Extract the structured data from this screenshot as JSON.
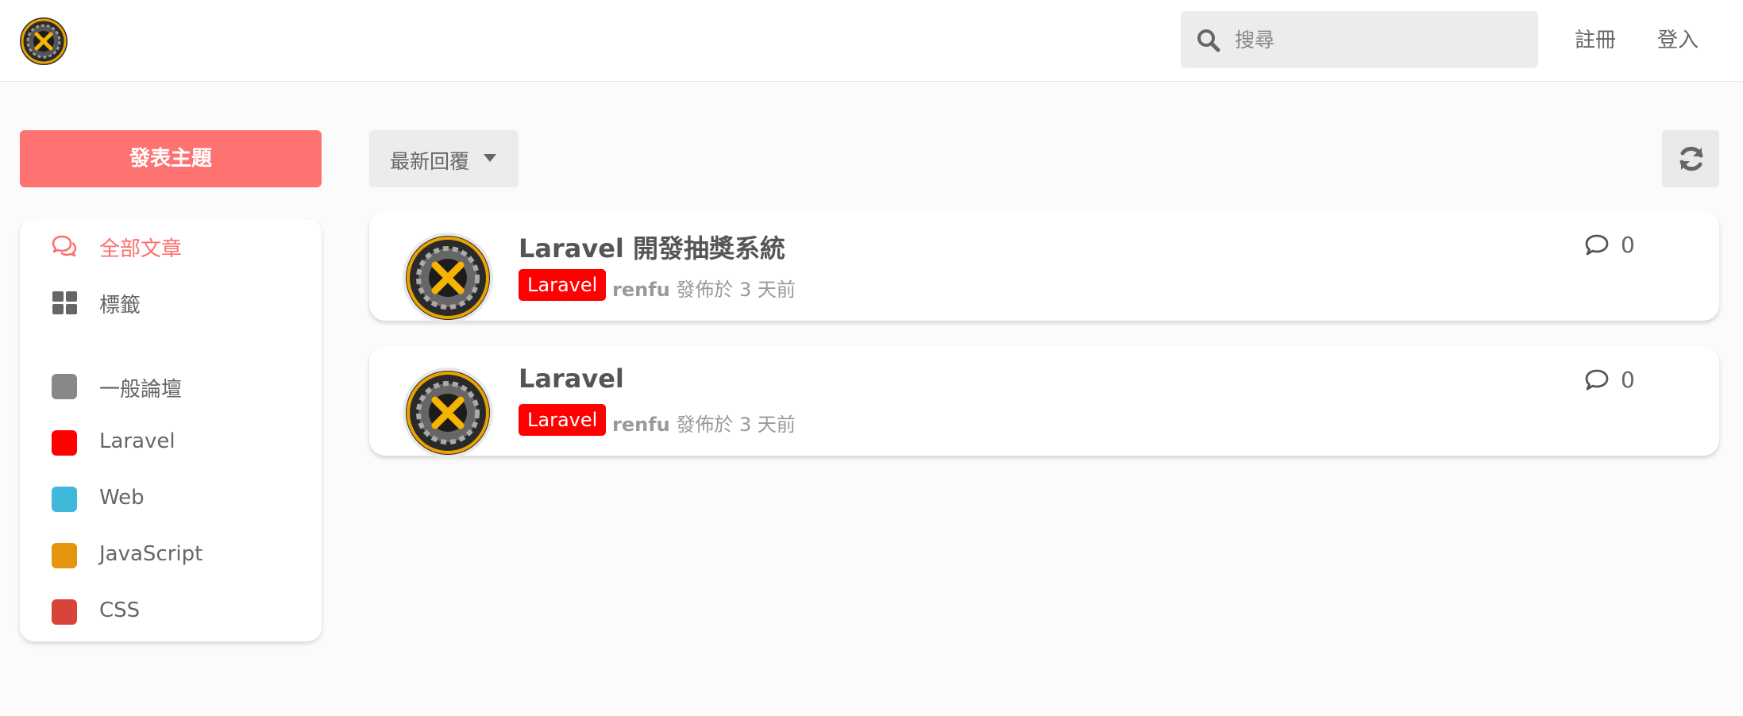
{
  "header": {
    "search_placeholder": "搜尋",
    "register_label": "註冊",
    "login_label": "登入"
  },
  "sidebar": {
    "new_topic_label": "發表主題",
    "nav": [
      {
        "label": "全部文章",
        "icon": "comments-icon",
        "active": true
      },
      {
        "label": "標籤",
        "icon": "grid-icon",
        "active": false
      }
    ],
    "categories": [
      {
        "label": "一般論壇",
        "color": "#888888"
      },
      {
        "label": "Laravel",
        "color": "#ff0000"
      },
      {
        "label": "Web",
        "color": "#3fb8dc"
      },
      {
        "label": "JavaScript",
        "color": "#e5940d"
      },
      {
        "label": "CSS",
        "color": "#d6443a"
      }
    ]
  },
  "toolbar": {
    "sort_label": "最新回覆",
    "refresh_icon": "refresh-icon"
  },
  "topics": [
    {
      "title": "Laravel 開發抽獎系統",
      "tag": "Laravel",
      "author": "renfu",
      "posted": "發佈於 3 天前",
      "comments": "0"
    },
    {
      "title": "Laravel",
      "tag": "Laravel",
      "author": "renfu",
      "posted": "發佈於 3 天前",
      "comments": "0"
    }
  ],
  "colors": {
    "accent": "#ff7272",
    "tag": "#ff0000"
  }
}
